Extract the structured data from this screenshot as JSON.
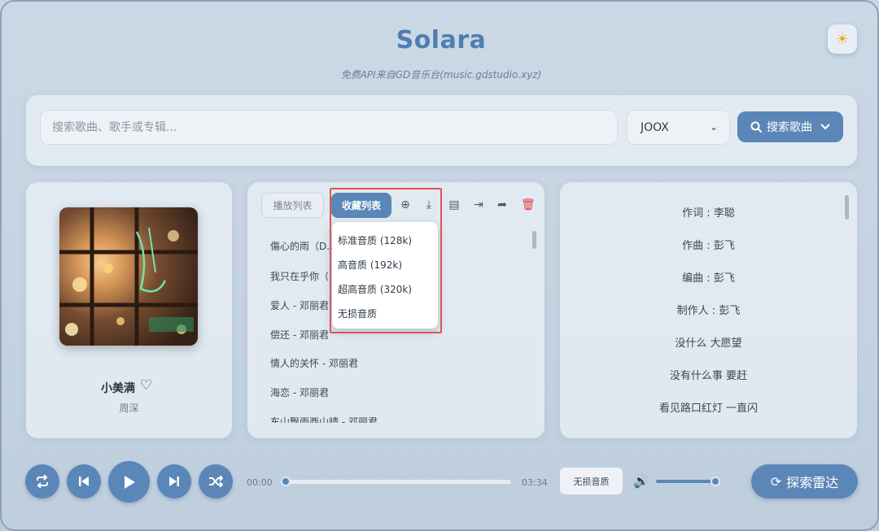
{
  "header": {
    "title": "Solara",
    "subtitle": "免费API来自GD音乐台(music.gdstudio.xyz)",
    "theme_icon": "sun-icon"
  },
  "search": {
    "placeholder": "搜索歌曲、歌手或专辑...",
    "value": "",
    "source": "JOOX",
    "button_label": "搜索歌曲"
  },
  "now_playing": {
    "title": "小美满",
    "artist": "周深"
  },
  "playlist_panel": {
    "tab_playlist": "播放列表",
    "tab_favorites": "收藏列表",
    "songs": [
      "傷心的雨（D...",
      "我只在乎你（...",
      "爱人 - 邓丽君",
      "偿还 - 邓丽君",
      "情人的关怀 - 邓丽君",
      "海恋 - 邓丽君",
      "东山飘雨西山晴 - 邓丽君"
    ]
  },
  "quality_menu": {
    "items": [
      "标准音质 (128k)",
      "高音质 (192k)",
      "超高音质 (320k)",
      "无损音质"
    ]
  },
  "lyrics": [
    "作词 : 李聪",
    "作曲 : 彭飞",
    "编曲 : 彭飞",
    "制作人 : 彭飞",
    "没什么 大愿望",
    "没有什么事 要赶",
    "看见路口红灯 一直闪"
  ],
  "player": {
    "current_time": "00:00",
    "total_time": "03:34",
    "progress": 0,
    "quality_label": "无损音质",
    "volume": 0.95,
    "radar_label": "探索雷达"
  },
  "colors": {
    "accent": "#5b86b8",
    "delete": "#e0423b",
    "highlight_border": "#e05555"
  }
}
